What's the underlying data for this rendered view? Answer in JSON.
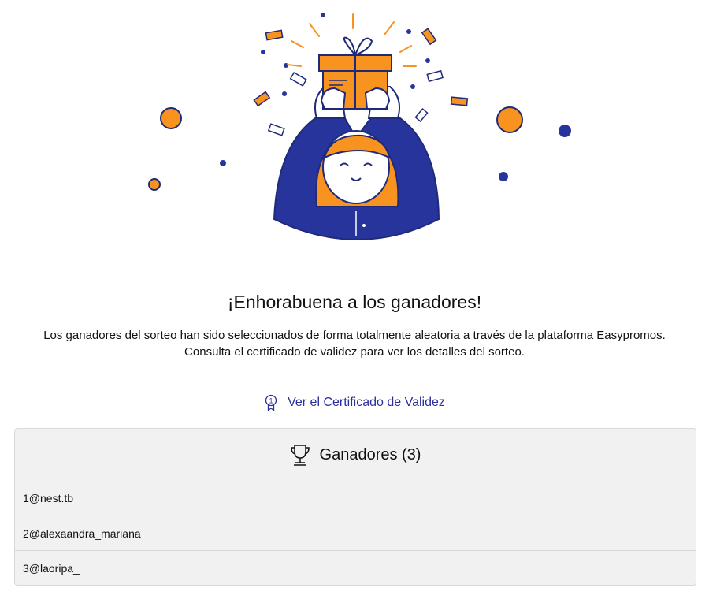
{
  "hero": {
    "illustration": "celebration-gift-person",
    "colors": {
      "orange": "#f7931e",
      "navy": "#26349b",
      "outline": "#1f2a7a",
      "skin": "#ffffff"
    }
  },
  "title": "¡Enhorabuena a los ganadores!",
  "description": "Los ganadores del sorteo han sido seleccionados de forma totalmente aleatoria a través de la plataforma Easypromos. Consulta el certificado de validez para ver los detalles del sorteo.",
  "certificate": {
    "icon": "award-ribbon-icon",
    "label": "Ver el Certificado de Validez",
    "color": "#2b2f9a"
  },
  "winners_panel": {
    "icon": "trophy-icon",
    "heading": "Ganadores (3)",
    "rows": [
      {
        "text": "1@nest.tb"
      },
      {
        "text": "2@alexaandra_mariana"
      },
      {
        "text": "3@laoripa_"
      }
    ]
  }
}
